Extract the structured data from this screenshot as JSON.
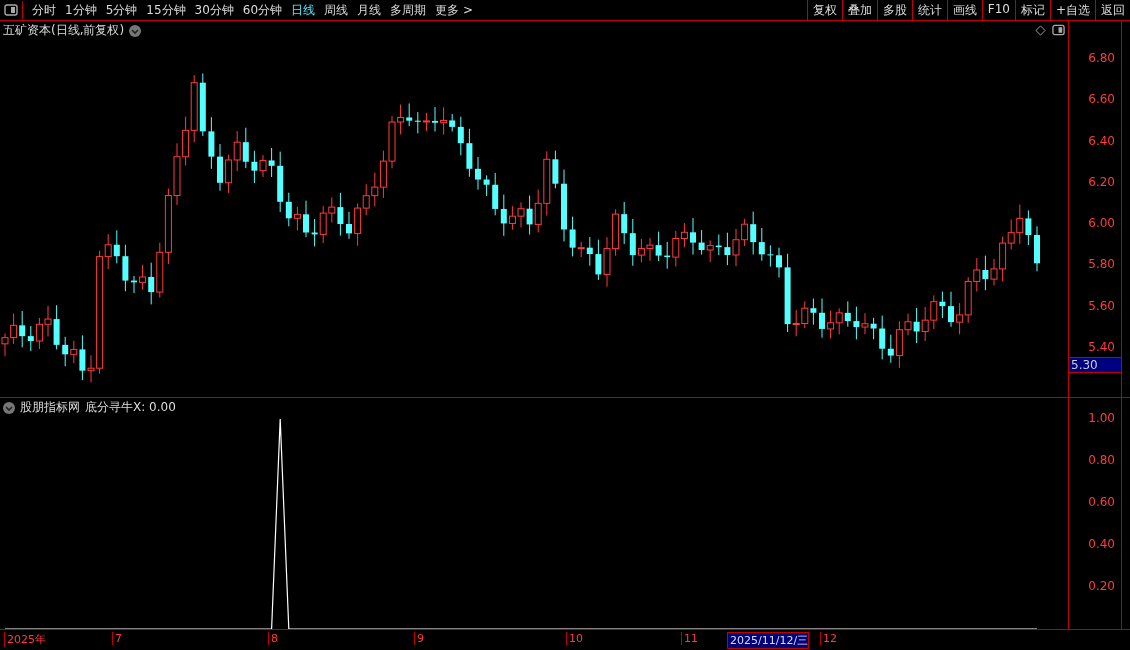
{
  "toolbar": {
    "periods": [
      {
        "label": "分时",
        "selected": false
      },
      {
        "label": "1分钟",
        "selected": false
      },
      {
        "label": "5分钟",
        "selected": false
      },
      {
        "label": "15分钟",
        "selected": false
      },
      {
        "label": "30分钟",
        "selected": false
      },
      {
        "label": "60分钟",
        "selected": false
      },
      {
        "label": "日线",
        "selected": true
      },
      {
        "label": "周线",
        "selected": false
      },
      {
        "label": "月线",
        "selected": false
      },
      {
        "label": "多周期",
        "selected": false
      },
      {
        "label": "更多 >",
        "selected": false
      }
    ],
    "buttons": [
      "复权",
      "叠加",
      "多股",
      "统计",
      "画线",
      "F10",
      "标记",
      "+自选",
      "返回"
    ]
  },
  "price_pane": {
    "title": "五矿资本(日线,前复权)",
    "axis_labels": [
      "6.80",
      "6.60",
      "6.40",
      "6.20",
      "6.00",
      "5.80",
      "5.60",
      "5.40"
    ],
    "current_price": "5.30"
  },
  "indicator_pane": {
    "title": "股朋指标网",
    "readout": "底分寻牛X: 0.00",
    "axis_labels": [
      "1.00",
      "0.80",
      "0.60",
      "0.40",
      "0.20"
    ]
  },
  "time_axis": [
    {
      "label": "2025年",
      "highlighted": false
    },
    {
      "label": "7",
      "highlighted": false
    },
    {
      "label": "8",
      "highlighted": false
    },
    {
      "label": "9",
      "highlighted": false
    },
    {
      "label": "10",
      "highlighted": false
    },
    {
      "label": "11",
      "highlighted": false
    },
    {
      "label": "2025/11/12/三",
      "highlighted": true
    },
    {
      "label": "12",
      "highlighted": false
    }
  ]
}
